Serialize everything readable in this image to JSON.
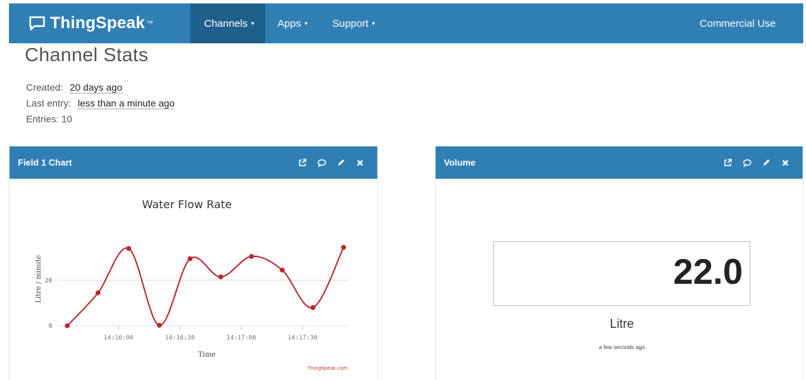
{
  "navbar": {
    "brand": "ThingSpeak",
    "trademark": "™",
    "items": [
      {
        "label": "Channels",
        "caret": "▾"
      },
      {
        "label": "Apps",
        "caret": "▾"
      },
      {
        "label": "Support",
        "caret": "▾"
      }
    ],
    "right_label": "Commercial Use",
    "color": "#2f7fb5",
    "active_color": "#1f5f8c"
  },
  "page": {
    "title": "Channel Stats",
    "created_label": "Created:",
    "created_value": "20 days ago",
    "last_entry_label": "Last entry:",
    "last_entry_value": "less than a minute ago",
    "entries_label": "Entries: 10"
  },
  "panels": {
    "chart": {
      "title": "Field 1 Chart",
      "tools": [
        "external-link-icon",
        "comment-icon",
        "pencil-icon",
        "close-icon"
      ]
    },
    "widget": {
      "title": "Volume",
      "tools": [
        "external-link-icon",
        "comment-icon",
        "pencil-icon",
        "close-icon"
      ],
      "value": "22.0",
      "unit": "Litre",
      "updated": "a few seconds ago"
    }
  },
  "chart_data": {
    "type": "line",
    "title": "Water Flow Rate",
    "xlabel": "Time",
    "ylabel": "Litre / minute",
    "credit": "ThingSpeak.com",
    "x_ticks": [
      "14:16:00",
      "14:16:30",
      "14:17:00",
      "14:17:30"
    ],
    "y_ticks": [
      0,
      20
    ],
    "ylim": [
      0,
      36
    ],
    "series": [
      {
        "color": "#b7282e",
        "x": [
          "14:15:35",
          "14:15:50",
          "14:16:05",
          "14:16:20",
          "14:16:35",
          "14:16:50",
          "14:17:05",
          "14:17:20",
          "14:17:35",
          "14:17:50"
        ],
        "y": [
          0,
          14.5,
          34,
          0.2,
          29.5,
          21.5,
          30.5,
          24.5,
          8,
          34.5
        ]
      }
    ],
    "grid": true
  }
}
